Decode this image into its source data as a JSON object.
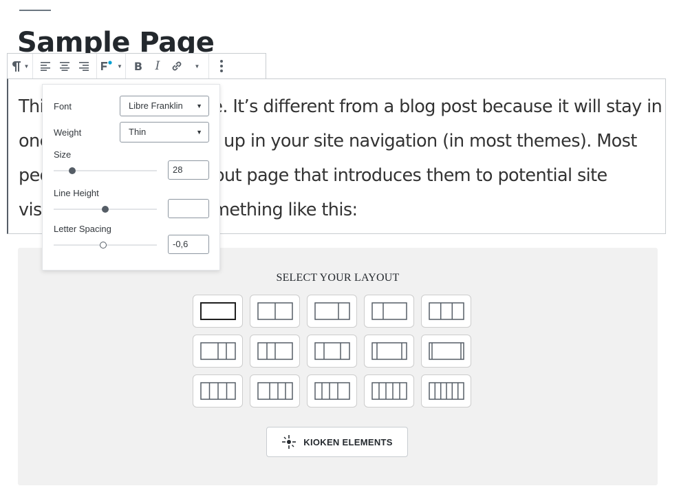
{
  "page": {
    "title": "Sample Page"
  },
  "paragraph": {
    "lines": [
      "This is an example page. It’s different from a blog post because it will stay in",
      "one place and will show up in your site navigation (in most themes). Most",
      "people start with an About page that introduces them to potential site",
      "visitors. It might say something like this:"
    ]
  },
  "toolbar": {
    "icons": [
      "paragraph-icon",
      "align-left-icon",
      "align-center-icon",
      "align-right-icon",
      "typography-icon",
      "bold-icon",
      "italic-icon",
      "link-icon",
      "more-options-icon"
    ],
    "bold_label": "B",
    "italic_label": "I"
  },
  "typography_panel": {
    "font_label": "Font",
    "font_value": "Libre Franklin",
    "weight_label": "Weight",
    "weight_value": "Thin",
    "size_label": "Size",
    "size_value": "28",
    "line_height_label": "Line Height",
    "line_height_value": "",
    "letter_spacing_label": "Letter Spacing",
    "letter_spacing_value": "-0,6"
  },
  "layout_selector": {
    "title": "SELECT YOUR LAYOUT",
    "button_label": "KIOKEN ELEMENTS"
  },
  "colors": {
    "accent": "#00a0d2",
    "text": "#23282d",
    "panel_bg": "#f1f1f1"
  }
}
